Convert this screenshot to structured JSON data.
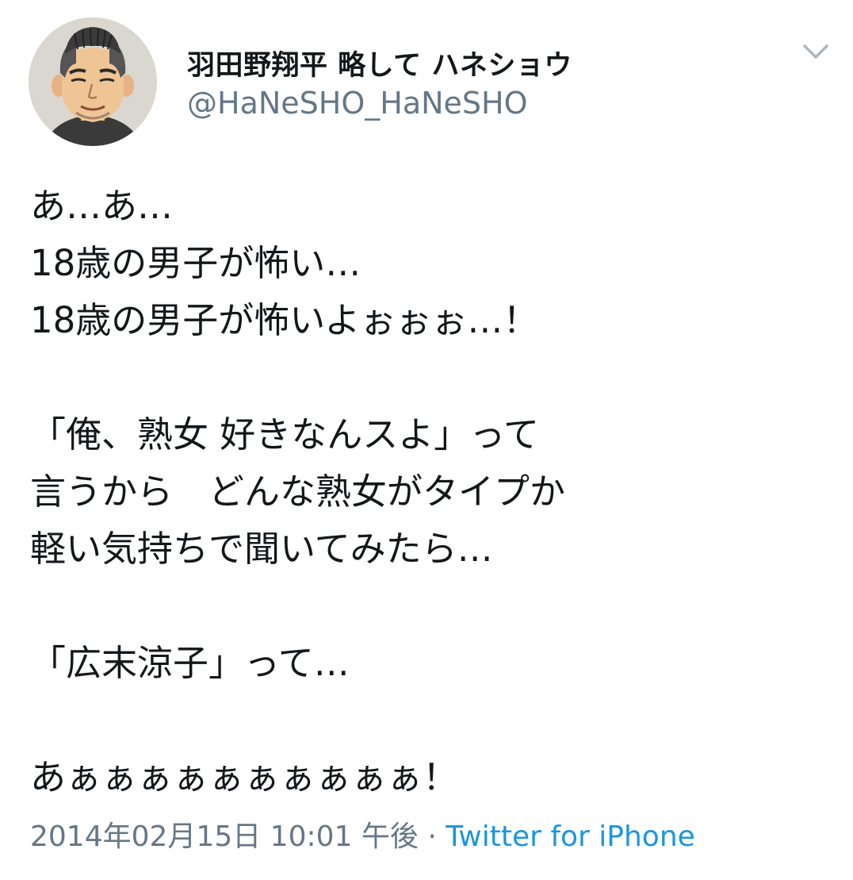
{
  "author": {
    "name": "羽田野翔平 略して ハネショウ",
    "handle": "@HaNeSHO_HaNeSHO"
  },
  "menu": {
    "icon": "chevron-down-icon"
  },
  "tweet": {
    "lines": [
      "あ…あ…",
      "18歳の男子が怖い…",
      "18歳の男子が怖いよぉぉぉ…！",
      "",
      "「俺、熟女 好きなんスよ」って",
      "言うから　どんな熟女がタイプか",
      "軽い気持ちで聞いてみたら…",
      "",
      "「広末涼子」って…",
      "",
      "あぁぁぁぁぁぁぁぁぁぁ！"
    ],
    "timestamp": "2014年02月15日 10:01 午後",
    "separator": "·",
    "source": "Twitter for iPhone"
  },
  "colors": {
    "text": "#14171a",
    "secondary": "#657786",
    "link": "#1b95e0",
    "chevron": "#aab8c2"
  }
}
